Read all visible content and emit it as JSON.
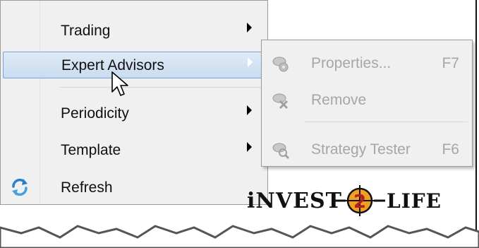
{
  "menu": {
    "items": [
      {
        "label": "Trading",
        "submenu": true
      },
      {
        "label": "Expert Advisors",
        "submenu": true,
        "highlighted": true
      },
      {
        "label": "Periodicity",
        "submenu": true
      },
      {
        "label": "Template",
        "submenu": true
      },
      {
        "label": "Refresh",
        "icon": "refresh-icon"
      }
    ]
  },
  "submenu": {
    "items": [
      {
        "label": "Properties...",
        "shortcut": "F7",
        "icon": "ea-properties-icon",
        "enabled": false
      },
      {
        "label": "Remove",
        "shortcut": "",
        "icon": "ea-remove-icon",
        "enabled": false
      },
      {
        "label": "Strategy Tester",
        "shortcut": "F6",
        "icon": "strategy-tester-icon",
        "enabled": false
      }
    ]
  },
  "branding": {
    "logo_text": "INVEST-2-LIFE"
  },
  "colors": {
    "highlight": "#c9dcf0",
    "highlight_border": "#7aa3d1",
    "disabled_text": "#a6a6a6",
    "logo_orange": "#f0a020"
  }
}
